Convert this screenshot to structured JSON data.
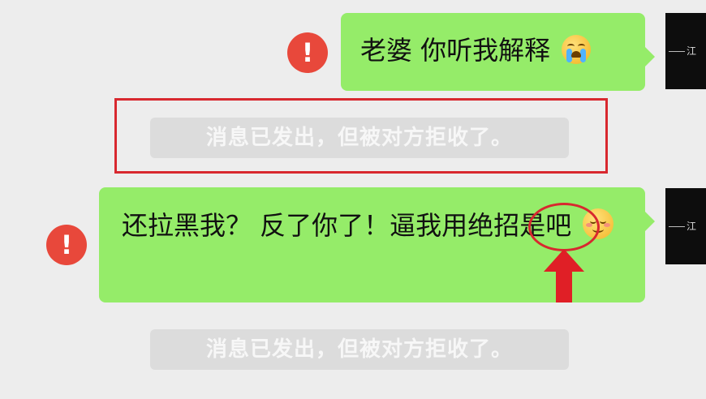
{
  "messages": [
    {
      "text": "老婆 你听我解释",
      "emoji": "crying-emoji",
      "status_icon": "exclamation-icon",
      "avatar_text": "江"
    },
    {
      "text_before": "还拉黑我？ 反了你了！逼我用",
      "highlight": "绝招",
      "text_after": "是吧",
      "emoji": "smiling-emoji",
      "status_icon": "exclamation-icon",
      "avatar_text": "江"
    }
  ],
  "system_notices": [
    "消息已发出，但被对方拒收了。",
    "消息已发出，但被对方拒收了。"
  ],
  "alert_glyph": "!",
  "colors": {
    "bubble": "#95ec69",
    "background": "#ededed",
    "alert": "#e8483b",
    "annotation": "#d8282f",
    "notice_bg": "#dcdcdc"
  }
}
